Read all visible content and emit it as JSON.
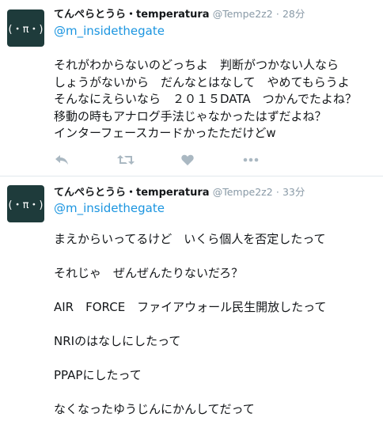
{
  "tweets": [
    {
      "avatar_text": "(・π・)",
      "name": "てんぺらとうら・temperatura",
      "handle": "@Tempe2z2",
      "separator": "·",
      "time": "28分",
      "reply_to": "@m_insidethegate",
      "lines": [
        "それがわからないのどっちよ　判断がつかない人なら",
        "しょうがないから　だんなとはなして　やめてもらうよ",
        "そんなにえらいなら　２０１５DATA　つかんでたよね？",
        "移動の時もアナログ手法じゃなかったはずだよね？",
        "インターフェースカードかったただけどw"
      ],
      "actions": [
        "reply-icon",
        "retweet-icon",
        "like-icon",
        "more-icon"
      ]
    },
    {
      "avatar_text": "(・π・)",
      "name": "てんぺらとうら・temperatura",
      "handle": "@Tempe2z2",
      "separator": "·",
      "time": "33分",
      "reply_to": "@m_insidethegate",
      "lines": [
        "まえからいってるけど　いくら個人を否定したって",
        "",
        "それじゃ　ぜんぜんたりないだろ？",
        "",
        "AIR　FORCE　ファイアウォール民生開放したって",
        "",
        "NRIのはなしにしたって",
        "",
        "PPAPにしたって",
        "",
        "なくなったゆうじんにかんしてだって"
      ]
    }
  ],
  "colors": {
    "name": "#14171a",
    "meta": "#8899a6",
    "link": "#1b95e0",
    "avatar_bg": "#1e3b3b",
    "divider": "#e1e8ed",
    "action_icon": "#aab8c2"
  }
}
